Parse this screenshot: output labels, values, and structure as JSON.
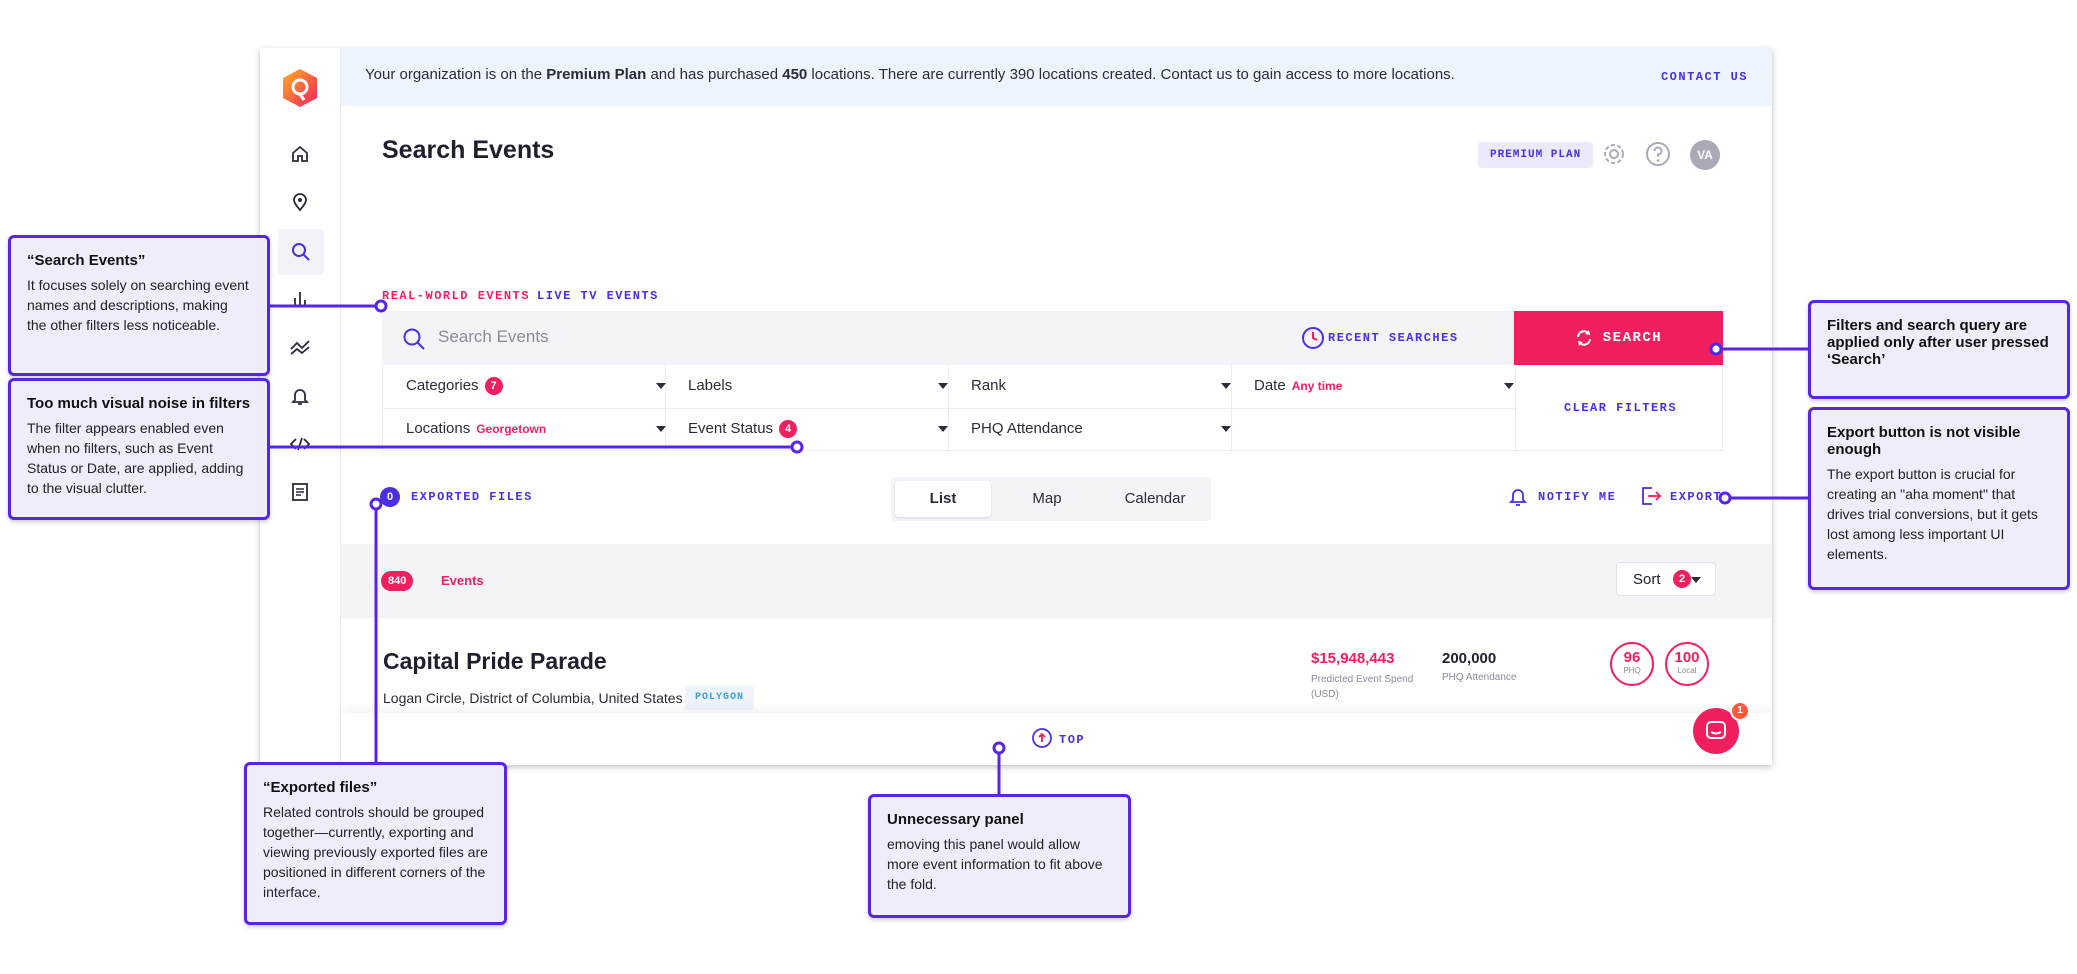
{
  "banner": {
    "prefix": "Your organization is on the ",
    "plan": "Premium Plan",
    "middle": " and has purchased ",
    "purchased": "450",
    "suffix": " locations. There are currently 390 locations created. Contact us to gain access to more locations.",
    "contact": "CONTACT US"
  },
  "header": {
    "title": "Search Events",
    "plan_badge": "PREMIUM PLAN",
    "avatar": "VA"
  },
  "tabs": [
    {
      "label": "REAL-WORLD EVENTS",
      "active": true
    },
    {
      "label": "LIVE TV EVENTS",
      "active": false
    }
  ],
  "search": {
    "placeholder": "Search Events",
    "recent": "RECENT SEARCHES",
    "button": "SEARCH",
    "clear": "CLEAR FILTERS"
  },
  "filters": {
    "categories": {
      "label": "Categories",
      "count": "7"
    },
    "labels": {
      "label": "Labels"
    },
    "rank": {
      "label": "Rank"
    },
    "date": {
      "label": "Date",
      "value": "Any time"
    },
    "locations": {
      "label": "Locations",
      "value": "Georgetown"
    },
    "event_status": {
      "label": "Event Status",
      "count": "4"
    },
    "phq_attendance": {
      "label": "PHQ Attendance"
    }
  },
  "toolbar": {
    "exported_count": "0",
    "exported_label": "EXPORTED FILES",
    "views": [
      "List",
      "Map",
      "Calendar"
    ],
    "active_view": "List",
    "notify": "NOTIFY ME",
    "export": "EXPORT"
  },
  "results": {
    "count": "840",
    "label": "Events",
    "sort_label": "Sort",
    "sort_count": "2"
  },
  "event": {
    "title": "Capital Pride Parade",
    "location": "Logan Circle, District of Columbia, United States",
    "tag": "POLYGON",
    "spend": "$15,948,443",
    "spend_label": "Predicted Event Spend (USD)",
    "attendance": "200,000",
    "attendance_label": "PHQ Attendance",
    "phq_rank": "96",
    "phq_label": "PHQ",
    "local_rank": "100",
    "local_label": "Local"
  },
  "footer": {
    "top": "TOP",
    "chat_badge": "1"
  },
  "annotations": {
    "search_events": {
      "title": "“Search Events”",
      "text": "It focuses solely on searching event names and descriptions, making the other filters less noticeable."
    },
    "visual_noise": {
      "title": "Too much visual noise in filters",
      "text": "The filter appears enabled even when no filters, such as Event Status or Date, are applied, adding to the visual clutter."
    },
    "exported_files": {
      "title": "“Exported files”",
      "text": "Related controls should be grouped together—currently, exporting and viewing previously exported files are positioned in different corners of the interface."
    },
    "unnecessary_panel": {
      "title": "Unnecessary panel",
      "text": "emoving this panel would allow more event information to fit above the fold."
    },
    "filters_applied": {
      "title": "Filters and search query are applied only after user pressed ‘Search’",
      "text": ""
    },
    "export_visibility": {
      "title": "Export button is not visible enough",
      "text": "The export button is crucial for creating an \"aha moment\" that drives trial conversions, but it gets lost among less important UI elements."
    }
  },
  "colors": {
    "accent": "#f21f5e",
    "primary": "#4a2fe0",
    "annotation": "#5726e4"
  }
}
